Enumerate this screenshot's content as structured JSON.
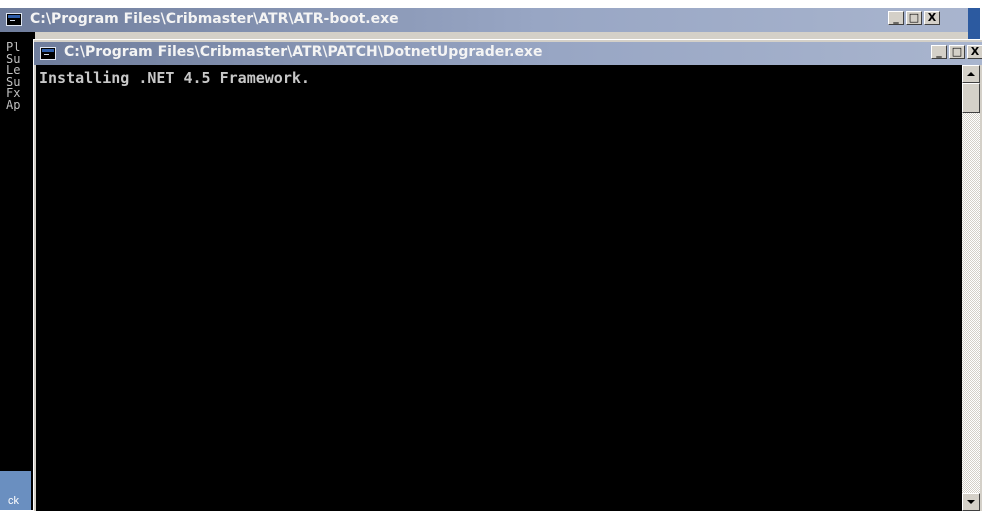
{
  "outer_window": {
    "title": "C:\\Program Files\\Cribmaster\\ATR\\ATR-boot.exe",
    "icon": "console-app-icon",
    "buttons": {
      "minimize": "_",
      "maximize": "□",
      "close": "X"
    },
    "visible_text_fragments": "Pl\nSu\nLe\nSu\nFx\nAp",
    "bottom_fragment": "ck"
  },
  "inner_window": {
    "title": "C:\\Program Files\\Cribmaster\\ATR\\PATCH\\DotnetUpgrader.exe",
    "icon": "console-app-icon",
    "buttons": {
      "minimize": "_",
      "maximize": "□",
      "close": "X"
    },
    "console_output": "Installing .NET 4.5 Framework."
  },
  "colors": {
    "titlebar_inactive": "#8a98b8",
    "console_bg": "#000000",
    "console_text": "#c0c0c0",
    "chrome": "#d4d0c8"
  }
}
